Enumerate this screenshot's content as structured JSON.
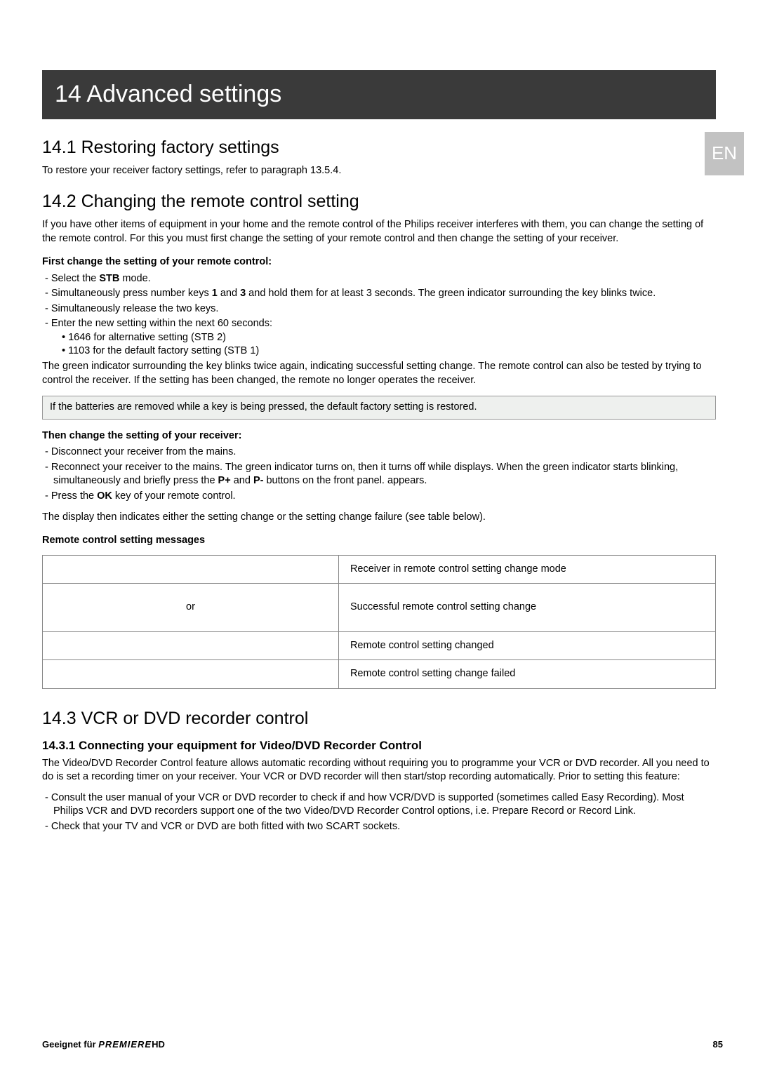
{
  "side_tab": "EN",
  "chapter": "14 Advanced settings",
  "s1": {
    "title": "14.1 Restoring factory settings",
    "text": "To restore your receiver factory settings, refer to paragraph 13.5.4."
  },
  "s2": {
    "title": "14.2 Changing the remote control setting",
    "intro": "If you have other items of equipment in your home and the remote control of the Philips receiver interferes with them, you can change the setting of the remote control. For this you must first change the setting of your remote control and then change the setting of your receiver.",
    "first_heading": "First change the setting of your remote control:",
    "first_item1_a": "Select the ",
    "first_item1_stb": "STB",
    "first_item1_b": " mode.",
    "first_item2_a": "Simultaneously press number keys ",
    "first_item2_one": "1",
    "first_item2_b": " and ",
    "first_item2_three": "3",
    "first_item2_c": " and hold them for at least 3 seconds. The green indicator surrounding the       key blinks twice.",
    "first_item3": "Simultaneously release the two keys.",
    "first_item4": "Enter the new setting within the next 60 seconds:",
    "first_item4a": "1646 for alternative setting (STB 2)",
    "first_item4b": "1103 for the default factory setting (STB 1)",
    "first_outro": "The green indicator surrounding the       key blinks twice again, indicating successful setting change. The remote control can also be tested by trying to control the receiver. If the setting has been changed, the remote no longer operates the receiver.",
    "note": "If the batteries are removed while a key is being pressed, the default factory setting is restored.",
    "then_heading": "Then change the setting of your receiver:",
    "then_item1": "Disconnect your receiver from the mains.",
    "then_item2_a": "Reconnect your receiver to the mains. The green indicator turns on, then it turns off while                                          displays. When the green indicator starts blinking, simultaneously and briefly press the ",
    "then_item2_p_plus": "P+",
    "then_item2_b": " and ",
    "then_item2_p_minus": "P-",
    "then_item2_c": " buttons on the front panel.                                           appears.",
    "then_item3_a": "Press the ",
    "then_item3_ok": "OK",
    "then_item3_b": " key of your remote control.",
    "then_outro": "The display then indicates either the setting change or the setting change failure (see table below).",
    "msg_heading": "Remote control setting messages",
    "table": {
      "r1l": "",
      "r1r": "Receiver in remote control setting change mode",
      "r2l": "or",
      "r2r": "Successful remote control setting change",
      "r3l": "",
      "r3r": "Remote control setting changed",
      "r4l": "",
      "r4r": "Remote control setting change failed"
    }
  },
  "s3": {
    "title": "14.3 VCR or DVD recorder control",
    "sub_title": "14.3.1 Connecting your equipment for Video/DVD Recorder Control",
    "intro": "The Video/DVD Recorder Control feature allows automatic recording without requiring you to programme your VCR or DVD recorder. All you need to do is set a recording timer on your receiver. Your VCR or DVD recorder will then start/stop recording automatically. Prior to setting this feature:",
    "item1": "Consult the user manual of your VCR or DVD recorder to check if and how VCR/DVD is supported (sometimes called Easy Recording). Most Philips VCR and DVD recorders support one of the two Video/DVD Recorder Control options, i.e. Prepare Record or Record Link.",
    "item2": "Check that your TV and VCR or DVD are both fitted with two SCART sockets."
  },
  "footer": {
    "left_a": "Geeignet für ",
    "left_brand": "PREMIERE",
    "left_hd": "HD",
    "page": "85"
  }
}
